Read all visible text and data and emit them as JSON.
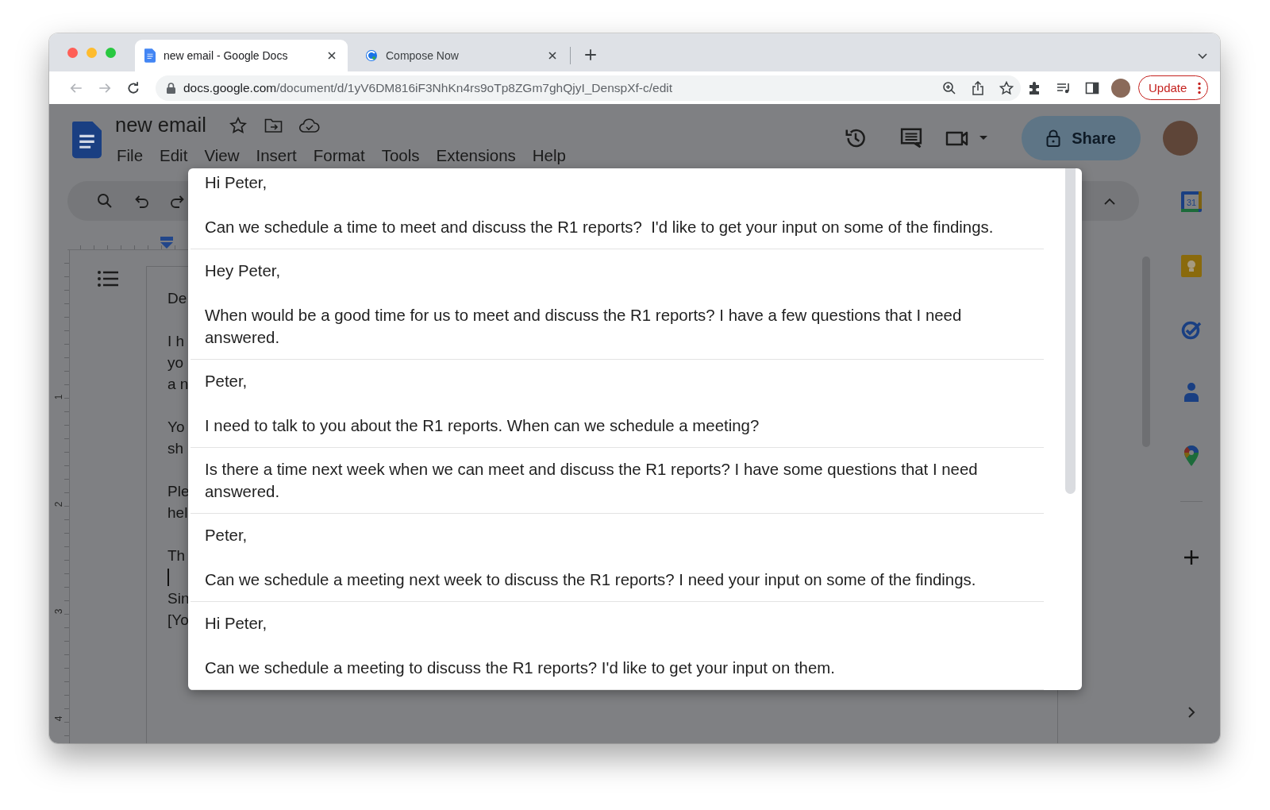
{
  "browser": {
    "tabs": [
      {
        "title": "new email - Google Docs",
        "selected": true
      },
      {
        "title": "Compose Now",
        "selected": false
      }
    ],
    "address": {
      "host": "docs.google.com",
      "path": "/document/d/1yV6DM816iF3NhKn4rs9oTp8ZGm7ghQjyI_DenspXf-c/edit"
    },
    "update_button": "Update"
  },
  "docs": {
    "title": "new email",
    "menu": [
      "File",
      "Edit",
      "View",
      "Insert",
      "Format",
      "Tools",
      "Extensions",
      "Help"
    ],
    "share_button": "Share",
    "ruler_numbers": [
      "1",
      "2",
      "3",
      "4"
    ],
    "paragraphs": [
      {
        "lines": [
          "De"
        ],
        "cursor_after": false
      },
      {
        "lines": [
          "I h",
          "yo",
          "a n"
        ],
        "cursor_after": false
      },
      {
        "lines": [
          "Yo",
          "sh"
        ],
        "cursor_after": false
      },
      {
        "lines": [
          "Ple",
          "hel"
        ],
        "cursor_after": false
      },
      {
        "lines": [
          "Th"
        ],
        "cursor_after": true
      },
      {
        "lines": [
          "Sin",
          "[Yo"
        ],
        "cursor_after": false
      }
    ]
  },
  "side_panel": {
    "calendar_day": "31"
  },
  "suggestions_popup": {
    "suggestions": [
      {
        "paragraphs": [
          "Hi Peter,",
          "Can we schedule a time to meet and discuss the R1 reports?  I'd like to get your input on some of the findings."
        ]
      },
      {
        "paragraphs": [
          "Hey Peter,",
          "When would be a good time for us to meet and discuss the R1 reports? I have a few questions that I need answered."
        ]
      },
      {
        "paragraphs": [
          "Peter,",
          "I need to talk to you about the R1 reports. When can we schedule a meeting?"
        ]
      },
      {
        "paragraphs": [
          "Is there a time next week when we can meet and discuss the R1 reports? I have some questions that I need answered."
        ]
      },
      {
        "paragraphs": [
          "Peter,",
          "Can we schedule a meeting next week to discuss the R1 reports? I need your input on some of the findings."
        ]
      },
      {
        "paragraphs": [
          "Hi Peter,",
          "Can we schedule a meeting to discuss the R1 reports? I'd like to get your input on them."
        ]
      }
    ]
  }
}
